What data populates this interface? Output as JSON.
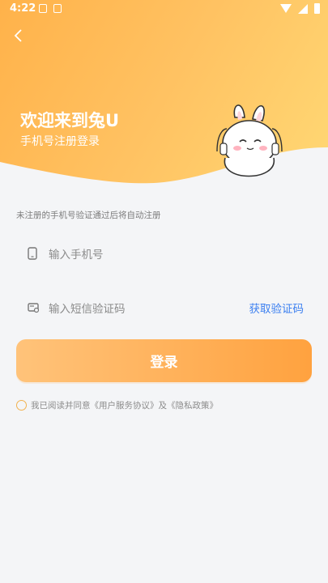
{
  "status_bar": {
    "time": "4:22"
  },
  "header": {
    "welcome": "欢迎来到兔U",
    "subtitle": "手机号注册登录"
  },
  "form": {
    "hint": "未注册的手机号验证通过后将自动注册",
    "phone_placeholder": "输入手机号",
    "code_placeholder": "输入短信验证码",
    "get_code": "获取验证码",
    "login_label": "登录"
  },
  "agreement": {
    "prefix": "我已阅读并同意",
    "user_agreement": "《用户服务协议》",
    "and": "及",
    "privacy_policy": "《隐私政策》"
  },
  "colors": {
    "accent": "#ffa23f",
    "link": "#3b7ff0"
  }
}
